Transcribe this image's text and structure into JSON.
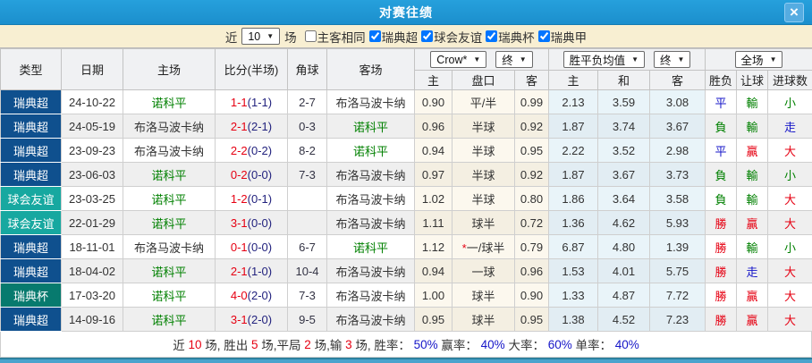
{
  "window": {
    "title": "对赛往绩",
    "close_glyph": "×"
  },
  "filter": {
    "near_label": "近",
    "count_value": "10",
    "matches_label": "场",
    "checkboxes": [
      {
        "label": "主客相同",
        "checked": false
      },
      {
        "label": "瑞典超",
        "checked": true
      },
      {
        "label": "球会友谊",
        "checked": true
      },
      {
        "label": "瑞典杯",
        "checked": true
      },
      {
        "label": "瑞典甲",
        "checked": true
      }
    ]
  },
  "table": {
    "headers_left": [
      "类型",
      "日期",
      "主场",
      "比分(半场)",
      "角球",
      "客场"
    ],
    "dropdowns": {
      "handicap_provider": "Crow*",
      "handicap_time": "终",
      "odds_avg": "胜平负均值",
      "odds_time": "终",
      "full_match": "全场"
    },
    "subheaders": [
      "主",
      "盘口",
      "客",
      "主",
      "和",
      "客",
      "胜负",
      "让球",
      "进球数"
    ],
    "rows": [
      {
        "league": "瑞典超",
        "date": "24-10-22",
        "home": "诺科平",
        "home_sel": true,
        "score": "1-1",
        "half": "(1-1)",
        "corner": "2-7",
        "away": "布洛马波卡纳",
        "away_sel": false,
        "h_home": "0.90",
        "star": false,
        "handicap": "平/半",
        "h_away": "0.99",
        "o_home": "2.13",
        "o_draw": "3.59",
        "o_away": "3.08",
        "result": [
          "平",
          "B"
        ],
        "give": [
          "輸",
          "G"
        ],
        "goal": [
          "小",
          "G"
        ]
      },
      {
        "league": "瑞典超",
        "date": "24-05-19",
        "home": "布洛马波卡纳",
        "home_sel": false,
        "score": "2-1",
        "half": "(2-1)",
        "corner": "0-3",
        "away": "诺科平",
        "away_sel": true,
        "h_home": "0.96",
        "star": false,
        "handicap": "半球",
        "h_away": "0.92",
        "o_home": "1.87",
        "o_draw": "3.74",
        "o_away": "3.67",
        "result": [
          "負",
          "G"
        ],
        "give": [
          "輸",
          "G"
        ],
        "goal": [
          "走",
          "B"
        ]
      },
      {
        "league": "瑞典超",
        "date": "23-09-23",
        "home": "布洛马波卡纳",
        "home_sel": false,
        "score": "2-2",
        "half": "(0-2)",
        "corner": "8-2",
        "away": "诺科平",
        "away_sel": true,
        "h_home": "0.94",
        "star": false,
        "handicap": "半球",
        "h_away": "0.95",
        "o_home": "2.22",
        "o_draw": "3.52",
        "o_away": "2.98",
        "result": [
          "平",
          "B"
        ],
        "give": [
          "贏",
          "R"
        ],
        "goal": [
          "大",
          "R"
        ]
      },
      {
        "league": "瑞典超",
        "date": "23-06-03",
        "home": "诺科平",
        "home_sel": true,
        "score": "0-2",
        "half": "(0-0)",
        "corner": "7-3",
        "away": "布洛马波卡纳",
        "away_sel": false,
        "h_home": "0.97",
        "star": false,
        "handicap": "半球",
        "h_away": "0.92",
        "o_home": "1.87",
        "o_draw": "3.67",
        "o_away": "3.73",
        "result": [
          "負",
          "G"
        ],
        "give": [
          "輸",
          "G"
        ],
        "goal": [
          "小",
          "G"
        ]
      },
      {
        "league": "球会友谊",
        "date": "23-03-25",
        "home": "诺科平",
        "home_sel": true,
        "score": "1-2",
        "half": "(0-1)",
        "corner": "",
        "away": "布洛马波卡纳",
        "away_sel": false,
        "h_home": "1.02",
        "star": false,
        "handicap": "半球",
        "h_away": "0.80",
        "o_home": "1.86",
        "o_draw": "3.64",
        "o_away": "3.58",
        "result": [
          "負",
          "G"
        ],
        "give": [
          "輸",
          "G"
        ],
        "goal": [
          "大",
          "R"
        ]
      },
      {
        "league": "球会友谊",
        "date": "22-01-29",
        "home": "诺科平",
        "home_sel": true,
        "score": "3-1",
        "half": "(0-0)",
        "corner": "",
        "away": "布洛马波卡纳",
        "away_sel": false,
        "h_home": "1.11",
        "star": false,
        "handicap": "球半",
        "h_away": "0.72",
        "o_home": "1.36",
        "o_draw": "4.62",
        "o_away": "5.93",
        "result": [
          "勝",
          "R"
        ],
        "give": [
          "贏",
          "R"
        ],
        "goal": [
          "大",
          "R"
        ]
      },
      {
        "league": "瑞典超",
        "date": "18-11-01",
        "home": "布洛马波卡纳",
        "home_sel": false,
        "score": "0-1",
        "half": "(0-0)",
        "corner": "6-7",
        "away": "诺科平",
        "away_sel": true,
        "h_home": "1.12",
        "star": true,
        "handicap": "一/球半",
        "h_away": "0.79",
        "o_home": "6.87",
        "o_draw": "4.80",
        "o_away": "1.39",
        "result": [
          "勝",
          "R"
        ],
        "give": [
          "輸",
          "G"
        ],
        "goal": [
          "小",
          "G"
        ]
      },
      {
        "league": "瑞典超",
        "date": "18-04-02",
        "home": "诺科平",
        "home_sel": true,
        "score": "2-1",
        "half": "(1-0)",
        "corner": "10-4",
        "away": "布洛马波卡纳",
        "away_sel": false,
        "h_home": "0.94",
        "star": false,
        "handicap": "一球",
        "h_away": "0.96",
        "o_home": "1.53",
        "o_draw": "4.01",
        "o_away": "5.75",
        "result": [
          "勝",
          "R"
        ],
        "give": [
          "走",
          "B"
        ],
        "goal": [
          "大",
          "R"
        ]
      },
      {
        "league": "瑞典杯",
        "date": "17-03-20",
        "home": "诺科平",
        "home_sel": true,
        "score": "4-0",
        "half": "(2-0)",
        "corner": "7-3",
        "away": "布洛马波卡纳",
        "away_sel": false,
        "h_home": "1.00",
        "star": false,
        "handicap": "球半",
        "h_away": "0.90",
        "o_home": "1.33",
        "o_draw": "4.87",
        "o_away": "7.72",
        "result": [
          "勝",
          "R"
        ],
        "give": [
          "贏",
          "R"
        ],
        "goal": [
          "大",
          "R"
        ]
      },
      {
        "league": "瑞典超",
        "date": "14-09-16",
        "home": "诺科平",
        "home_sel": true,
        "score": "3-1",
        "half": "(2-0)",
        "corner": "9-5",
        "away": "布洛马波卡纳",
        "away_sel": false,
        "h_home": "0.95",
        "star": false,
        "handicap": "球半",
        "h_away": "0.95",
        "o_home": "1.38",
        "o_draw": "4.52",
        "o_away": "7.23",
        "result": [
          "勝",
          "R"
        ],
        "give": [
          "贏",
          "R"
        ],
        "goal": [
          "大",
          "R"
        ]
      }
    ]
  },
  "summary": {
    "segments": [
      [
        "近 ",
        "K"
      ],
      [
        "10",
        "R"
      ],
      [
        " 场, 胜出 ",
        "K"
      ],
      [
        "5",
        "R"
      ],
      [
        " 场,平局 ",
        "K"
      ],
      [
        "2",
        "R"
      ],
      [
        " 场,输 ",
        "K"
      ],
      [
        "3",
        "R"
      ],
      [
        " 场, 胜率： ",
        "K"
      ],
      [
        "50%",
        "B"
      ],
      [
        " 赢率： ",
        "K"
      ],
      [
        "40%",
        "B"
      ],
      [
        " 大率： ",
        "K"
      ],
      [
        "60%",
        "B"
      ],
      [
        " 单率： ",
        "K"
      ],
      [
        "40%",
        "B"
      ]
    ]
  },
  "colors": {
    "league": {
      "瑞典超": "#0f508e",
      "球会友谊": "#17a8a0",
      "瑞典杯": "#077a6e"
    },
    "team_green": "#008000",
    "text_dark": "#333333",
    "rgb": {
      "R": "#e60012",
      "G": "#008000",
      "B": "#1616c8",
      "K": "#333333"
    }
  }
}
